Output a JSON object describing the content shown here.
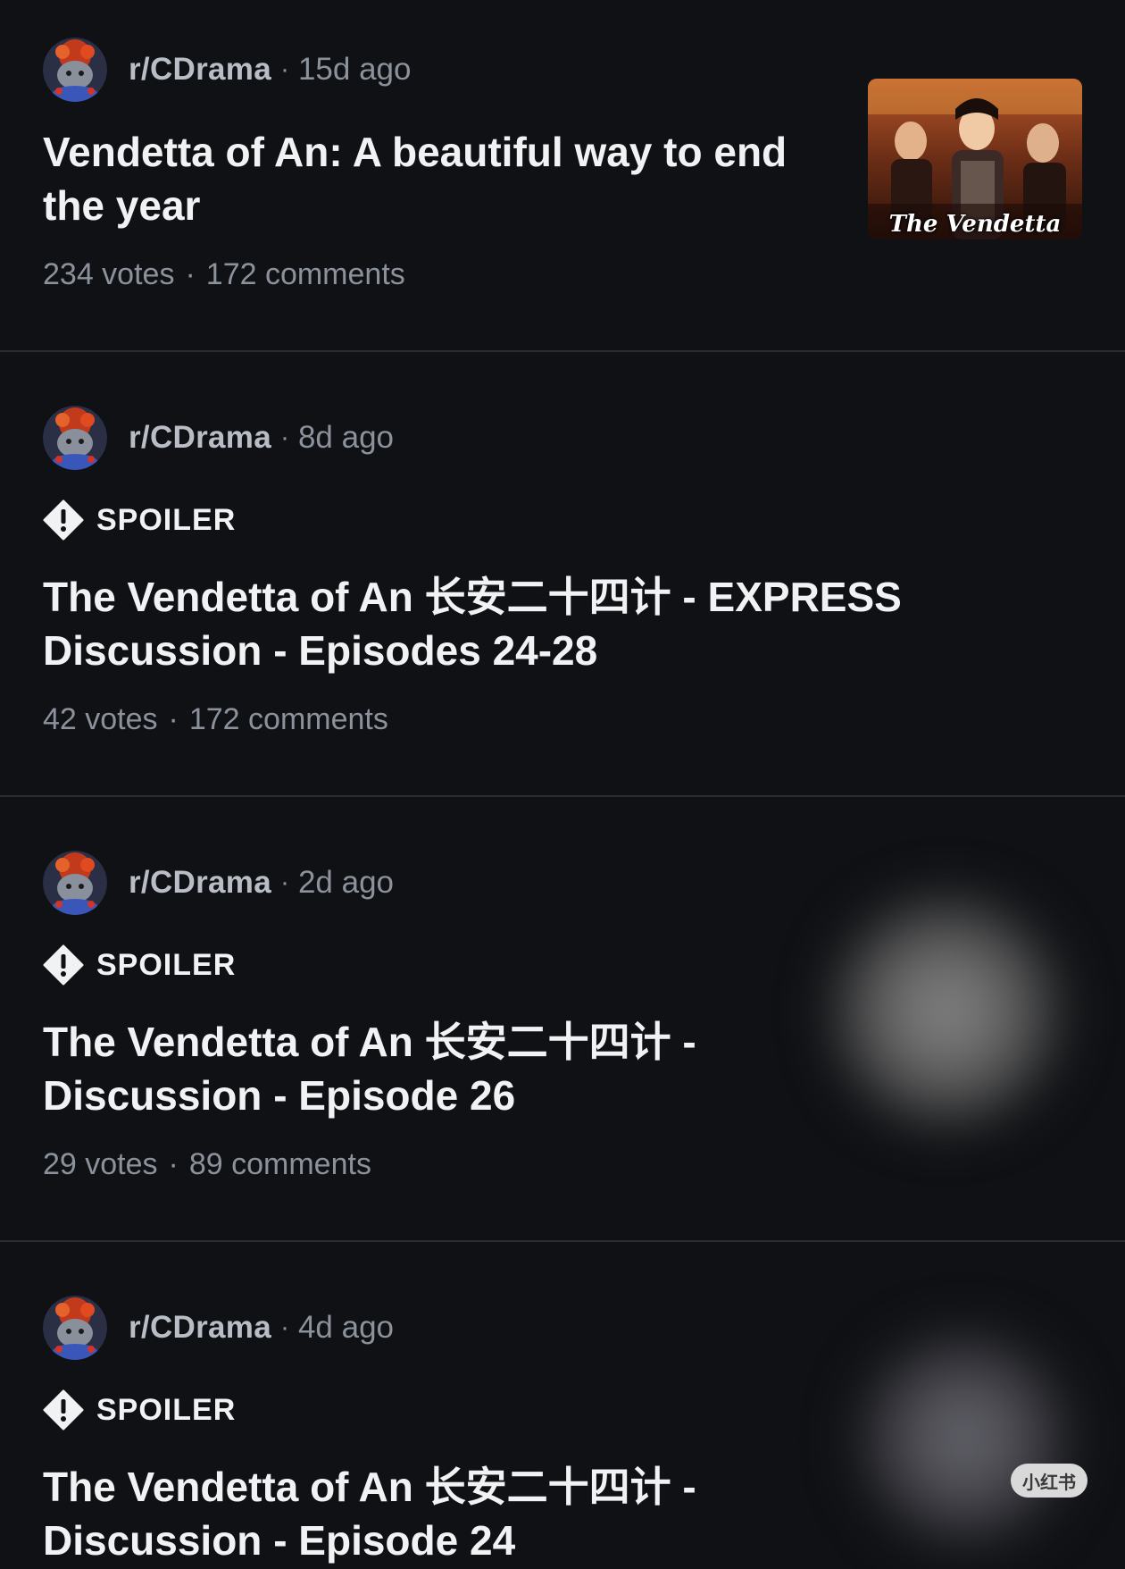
{
  "posts": [
    {
      "subreddit": "r/CDrama",
      "separator": "·",
      "age": "15d ago",
      "spoiler": "",
      "title": "Vendetta of An: A beautiful way to end the year",
      "votes": "234 votes",
      "comments": "172 comments",
      "thumbnail_caption": "The Vendetta"
    },
    {
      "subreddit": "r/CDrama",
      "separator": "·",
      "age": "8d ago",
      "spoiler": "SPOILER",
      "title": "The Vendetta of An 长安二十四计 - EXPRESS Discussion - Episodes 24-28",
      "votes": "42 votes",
      "comments": "172 comments"
    },
    {
      "subreddit": "r/CDrama",
      "separator": "·",
      "age": "2d ago",
      "spoiler": "SPOILER",
      "title": "The Vendetta of An 长安二十四计 - Discussion - Episode 26",
      "votes": "29 votes",
      "comments": "89 comments"
    },
    {
      "subreddit": "r/CDrama",
      "separator": "·",
      "age": "4d ago",
      "spoiler": "SPOILER",
      "title": "The Vendetta of An 长安二十四计 - Discussion - Episode 24",
      "votes": "",
      "comments": ""
    }
  ],
  "meta_dot": "·",
  "icons": {
    "avatar": "subreddit-avatar-icon",
    "spoiler": "spoiler-warning-icon"
  },
  "colors": {
    "background": "#0f1114",
    "divider": "#2a2d32",
    "title": "#f1f2f4",
    "meta": "#8c929b",
    "subreddit": "#b9bec6"
  },
  "watermark": "小红书"
}
